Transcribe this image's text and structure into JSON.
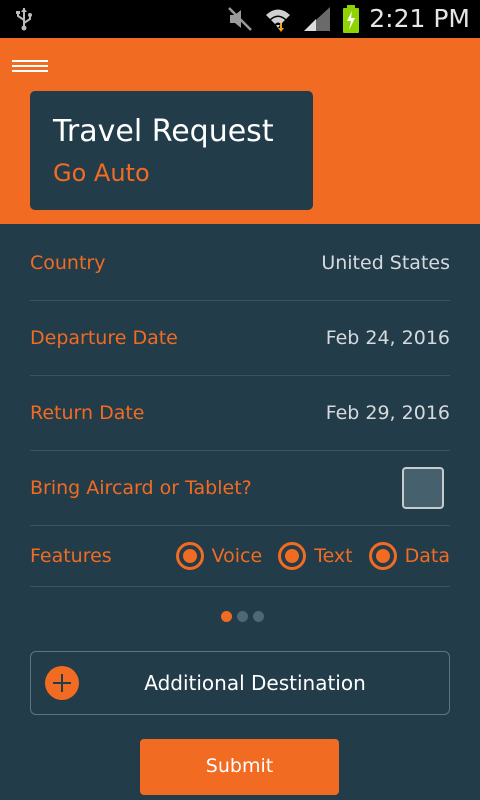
{
  "status_bar": {
    "time": "2:21 PM",
    "icons": [
      "usb-icon",
      "mute-icon",
      "wifi-icon",
      "signal-icon",
      "battery-charging-icon"
    ]
  },
  "header": {
    "menu_icon": "hamburger-icon",
    "title": "Travel Request",
    "subtitle": "Go Auto"
  },
  "form": {
    "country": {
      "label": "Country",
      "value": "United States"
    },
    "departure": {
      "label": "Departure Date",
      "value": "Feb 24, 2016"
    },
    "return": {
      "label": "Return Date",
      "value": "Feb 29, 2016"
    },
    "aircard": {
      "label": "Bring Aircard or Tablet?",
      "checked": false
    },
    "features": {
      "label": "Features",
      "options": [
        {
          "label": "Voice",
          "selected": true
        },
        {
          "label": "Text",
          "selected": true
        },
        {
          "label": "Data",
          "selected": true
        }
      ]
    }
  },
  "pager": {
    "pages": 3,
    "active": 0
  },
  "actions": {
    "add_destination": "Additional Destination",
    "submit": "Submit"
  },
  "colors": {
    "accent": "#f26b22",
    "background": "#223c4a",
    "status_bar": "#000000"
  }
}
